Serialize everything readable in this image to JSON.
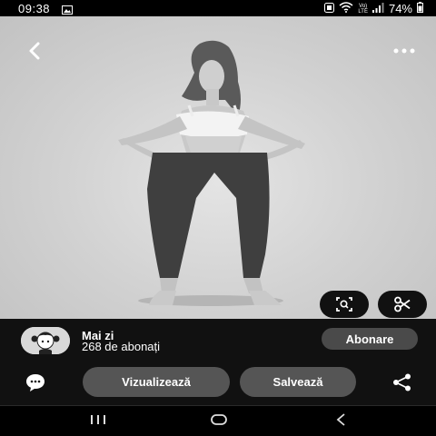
{
  "status": {
    "time": "09:38",
    "network": "Vo)\nLTE",
    "battery": "74%",
    "icons": [
      "image-icon",
      "nfc-icon",
      "wifi-icon",
      "signal-icon",
      "battery-icon"
    ]
  },
  "pin": {
    "image_desc": "black and white photo of woman in sports bra and leggings",
    "top_bar_icons": [
      "back-icon",
      "more-icon"
    ],
    "overlay_icons": [
      "visual-search-icon",
      "scissors-icon"
    ]
  },
  "creator": {
    "name": "Mai zi",
    "subscribers": "268 de abonați",
    "subscribe_label": "Abonare"
  },
  "actions": {
    "visit_label": "Vizualizează",
    "save_label": "Salvează",
    "icons": [
      "comment-icon",
      "share-icon"
    ]
  },
  "nav": {
    "icons": [
      "recent-apps-icon",
      "home-icon",
      "back-nav-icon"
    ]
  },
  "colors": {
    "panel": "#111111",
    "button": "#555555",
    "subscribe": "#4a4a4a"
  }
}
